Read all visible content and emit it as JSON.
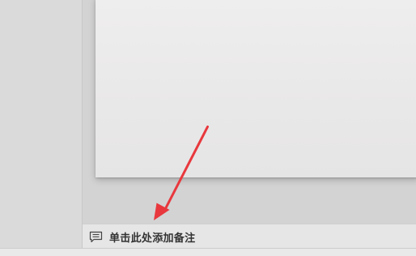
{
  "notes": {
    "placeholder": "单击此处添加备注",
    "icon": "notes-icon"
  },
  "annotation": {
    "type": "arrow",
    "color": "#e8383d"
  }
}
